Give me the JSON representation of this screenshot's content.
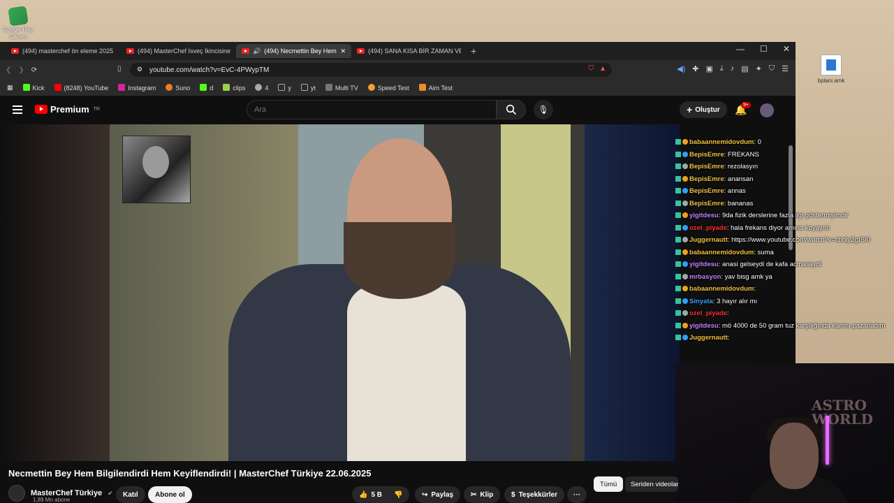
{
  "desktop": {
    "google_play_label": "Google Play Games",
    "file_label": "bplani.amk"
  },
  "browser": {
    "tabs": [
      {
        "label": "(494) masterchef ön eleme 2025 - Yo"
      },
      {
        "label": "(494) MasterChef İsveç İkincisine Kaş"
      },
      {
        "label": "(494) Necmettin Bey Hem Bil",
        "active": true
      },
      {
        "label": "(494) SANA KISA BİR ZAMAN VERİYO"
      }
    ],
    "new_tab": "+",
    "url": "youtube.com/watch?v=EvC-4PWypTM",
    "bookmarks": [
      {
        "label": "Kick",
        "color": "#53fc18"
      },
      {
        "label": "(8248) YouTube",
        "color": "#ff0000"
      },
      {
        "label": "Instagram",
        "color": "#d6249f"
      },
      {
        "label": "Suno",
        "color": "#f07b2a"
      },
      {
        "label": "d",
        "color": "#53fc18"
      },
      {
        "label": "clips",
        "color": "#9bd14a"
      },
      {
        "label": "4",
        "color": "#aaaaaa"
      },
      {
        "label": "y",
        "color": "#aaaaaa"
      },
      {
        "label": "yt",
        "color": "#aaaaaa"
      },
      {
        "label": "Multi TV",
        "color": "#aaaaaa"
      },
      {
        "label": "Speed Test",
        "color": "#f0a030"
      },
      {
        "label": "Aim Test",
        "color": "#f08a30"
      }
    ]
  },
  "youtube": {
    "brand": "Premium",
    "brand_region": "TR",
    "search_placeholder": "Ara",
    "create_label": "Oluştur",
    "notif_count": "9+",
    "video_title": "Necmettin Bey Hem Bilgilendirdi Hem Keyiflendirdi! | MasterChef Türkiye 22.06.2025",
    "channel_name": "MasterChef Türkiye",
    "channel_subs": "1,89 Mn abone",
    "join_label": "Katıl",
    "subscribe_label": "Abone ol",
    "likes": "5 B",
    "share_label": "Paylaş",
    "clip_label": "Klip",
    "thanks_label": "Teşekkürler",
    "more_label": "···",
    "filter_all": "Tümü",
    "filter_series": "Seriden videolar"
  },
  "chat": [
    {
      "user": "babaannemidovdum",
      "msg": "0",
      "color": "#f0c040"
    },
    {
      "user": "BepisEmre",
      "msg": "FREKANS",
      "color": "#f0c040"
    },
    {
      "user": "BepisEmre",
      "msg": "rezolasyın",
      "color": "#f0c040"
    },
    {
      "user": "BepisEmre",
      "msg": "anansan",
      "color": "#f0c040"
    },
    {
      "user": "BepisEmre",
      "msg": "annas",
      "color": "#f0c040"
    },
    {
      "user": "BepisEmre",
      "msg": "bananas",
      "color": "#f0c040"
    },
    {
      "user": "yigitdesu",
      "msg": "9da fizik derslerine fazla ilgi göstermişimdir",
      "color": "#c080ff"
    },
    {
      "user": "ozel_piyade",
      "msg": "hala frekans diyor amına koyayım",
      "color": "#ff3030"
    },
    {
      "user": "Juggernautt",
      "msg": "https://www.youtube.com/watch?v=cbdiyZgISI0",
      "color": "#f0c040"
    },
    {
      "user": "babaannemidovdum",
      "msg": "suma",
      "color": "#f0c040"
    },
    {
      "user": "yigitdesu",
      "msg": "anasi gelseydi de kafa acmasaydi",
      "color": "#c080ff"
    },
    {
      "user": "mrbasyon",
      "msg": "yav bisg amk ya",
      "color": "#c080ff"
    },
    {
      "user": "babaannemidovdum",
      "msg": "",
      "color": "#f0c040"
    },
    {
      "user": "Sinyata",
      "msg": "3 hayır alır mı",
      "color": "#40a0ff"
    },
    {
      "user": "ozel_piyade",
      "msg": "",
      "color": "#ff3030"
    },
    {
      "user": "yigitdesu",
      "msg": "mö 4000 de 50 gram tuz karşılığında karımı pazarladım",
      "color": "#c080ff"
    },
    {
      "user": "Juggernautt",
      "msg": "",
      "color": "#f0c040"
    }
  ],
  "webcam": {
    "poster_text": "ASTRO WORLD"
  }
}
